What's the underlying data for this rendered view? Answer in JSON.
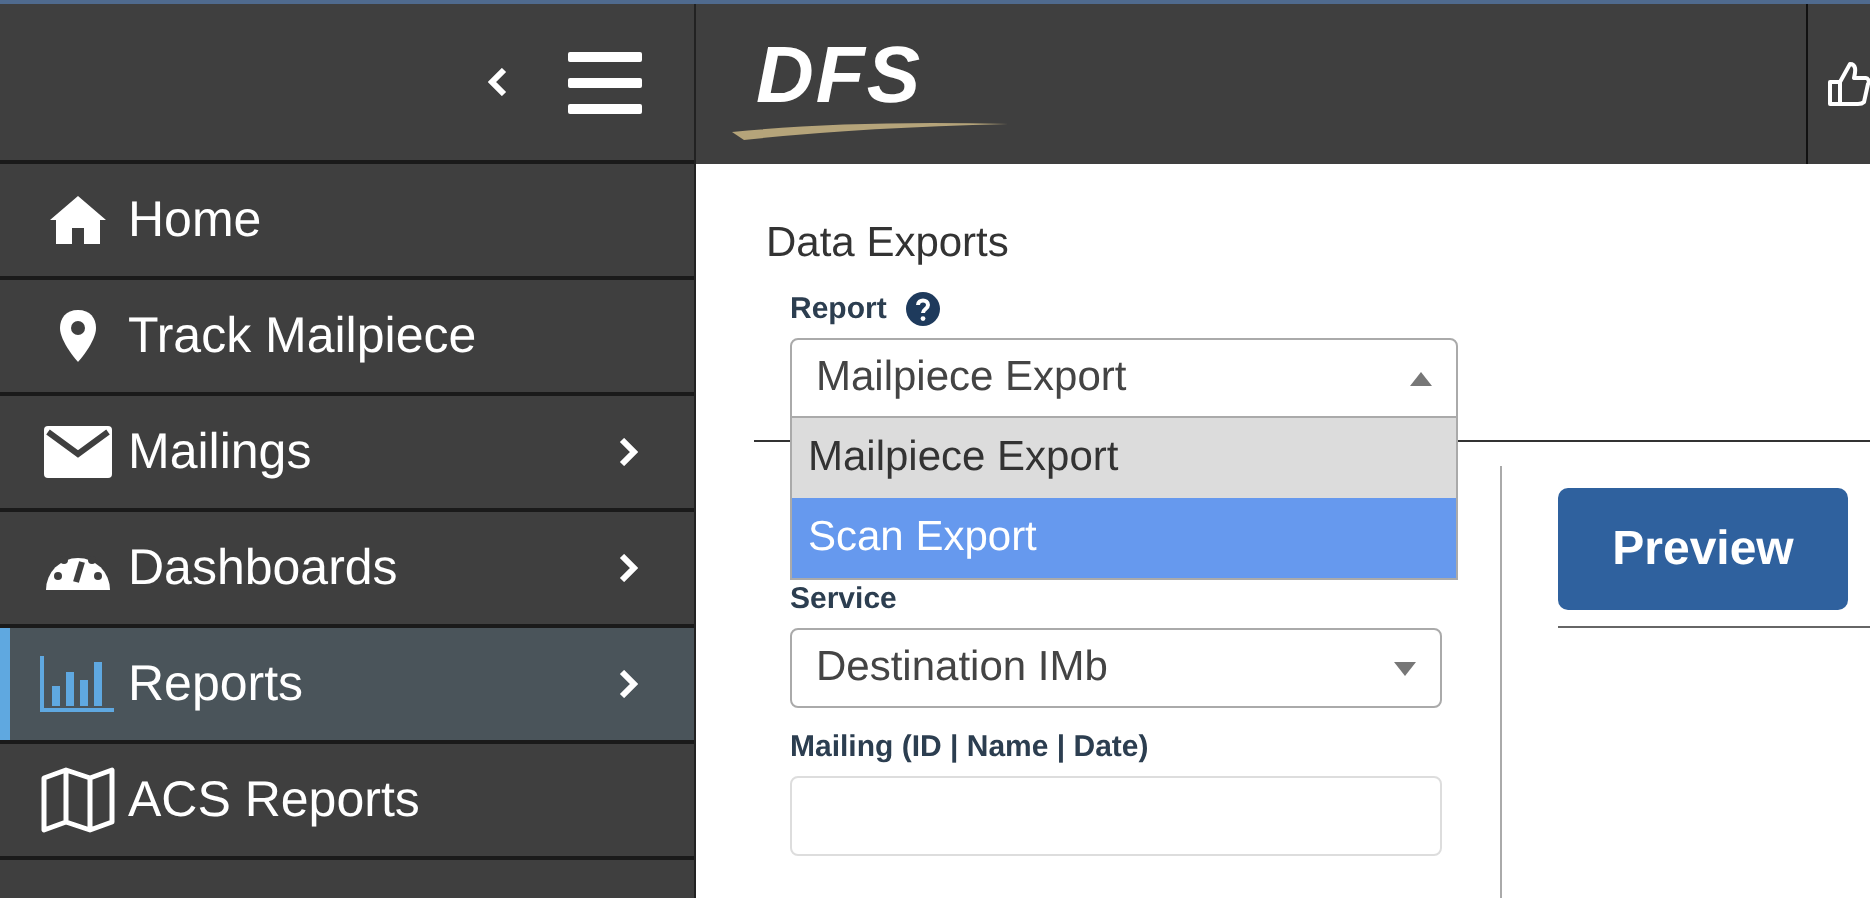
{
  "sidebar": {
    "items": [
      {
        "label": "Home",
        "kind": "home",
        "has_submenu": false,
        "selected": false
      },
      {
        "label": "Track Mailpiece",
        "kind": "pin",
        "has_submenu": false,
        "selected": false
      },
      {
        "label": "Mailings",
        "kind": "envelope",
        "has_submenu": true,
        "selected": false
      },
      {
        "label": "Dashboards",
        "kind": "gauge",
        "has_submenu": true,
        "selected": false
      },
      {
        "label": "Reports",
        "kind": "chart",
        "has_submenu": true,
        "selected": true
      },
      {
        "label": "ACS Reports",
        "kind": "map",
        "has_submenu": false,
        "selected": false
      }
    ]
  },
  "logo": {
    "text": "DFS"
  },
  "page_title": "Data Exports",
  "report": {
    "label": "Report",
    "value": "Mailpiece Export",
    "options": [
      {
        "label": "Mailpiece Export",
        "selected": true,
        "highlighted": false
      },
      {
        "label": "Scan Export",
        "selected": false,
        "highlighted": true
      }
    ]
  },
  "service": {
    "label": "Service",
    "value": "Destination IMb"
  },
  "mailing": {
    "label": "Mailing (ID | Name | Date)"
  },
  "preview_button": "Preview"
}
